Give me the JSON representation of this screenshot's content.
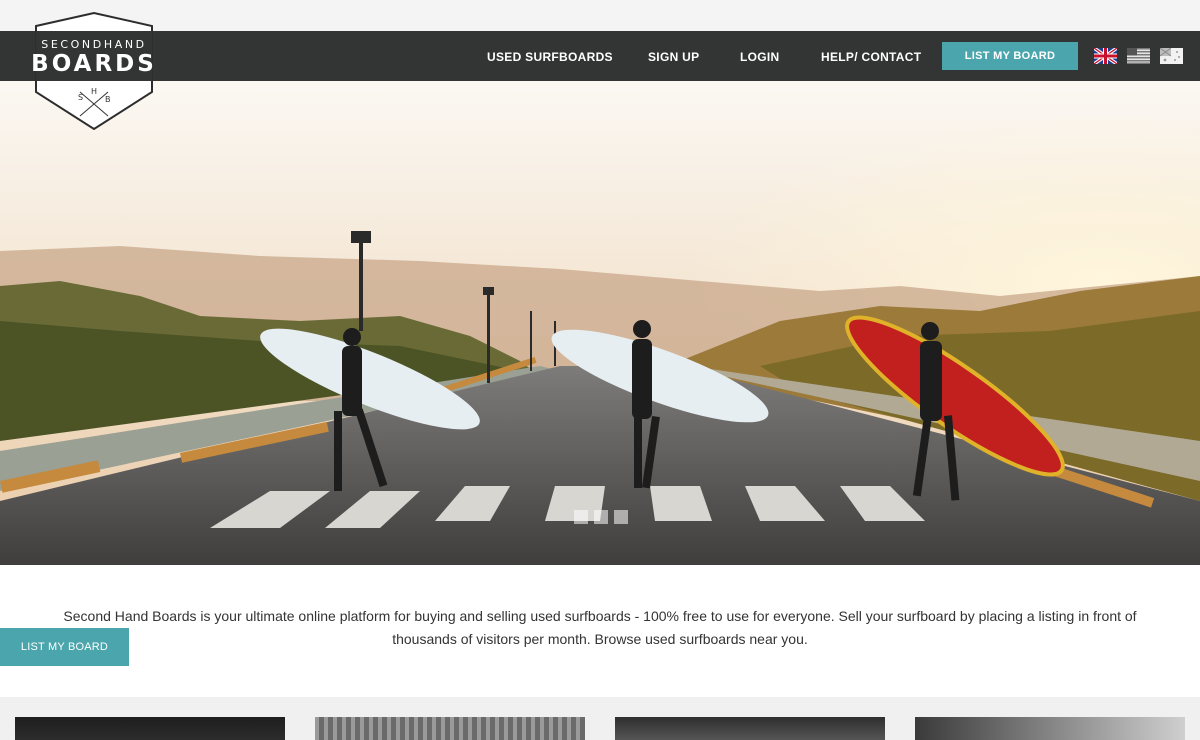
{
  "header": {
    "logo": {
      "top_text": "SECONDHAND",
      "main_text": "BOARDS",
      "monogram": [
        "S",
        "H",
        "B"
      ]
    },
    "nav": [
      {
        "label": "USED SURFBOARDS"
      },
      {
        "label": "SIGN UP"
      },
      {
        "label": "LOGIN"
      },
      {
        "label": "HELP/ CONTACT"
      }
    ],
    "cta_label": "LIST MY BOARD",
    "flags": [
      "uk-flag-icon",
      "us-flag-icon",
      "au-flag-icon"
    ]
  },
  "hero": {
    "image": "surfers-crossing-road-at-sunset",
    "slide_count": 3,
    "active_slide": 1
  },
  "intro": {
    "text": "Second Hand Boards is your ultimate online platform for buying and selling used surfboards - 100% free to use for everyone. Sell your surfboard by placing a listing in front of thousands of visitors per month. Browse used surfboards near you."
  },
  "side_cta_label": "LIST MY BOARD",
  "thumbnails": [
    "thumbnail-1",
    "thumbnail-2",
    "thumbnail-3",
    "thumbnail-4"
  ],
  "colors": {
    "navbar": "#333534",
    "accent": "#4ba5ac",
    "text": "#333333"
  }
}
